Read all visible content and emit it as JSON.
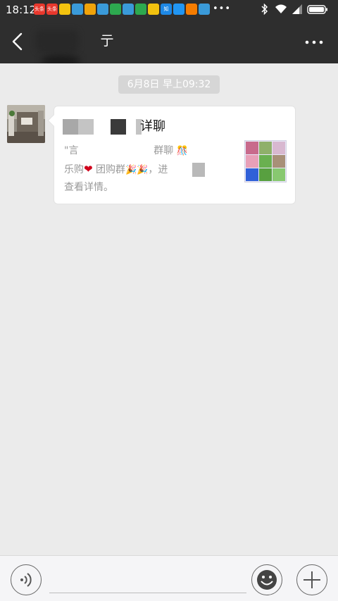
{
  "status_bar": {
    "time": "18:12",
    "notification_icons": [
      {
        "name": "toutiao-icon",
        "label": "头条",
        "color": "#e8382d"
      },
      {
        "name": "toutiao-icon",
        "label": "头条",
        "color": "#e8382d"
      },
      {
        "name": "app-yellow-icon",
        "label": "",
        "color": "#f2c20f"
      },
      {
        "name": "video-play-icon",
        "label": "",
        "color": "#3a9ad9"
      },
      {
        "name": "app-news-icon",
        "label": "",
        "color": "#f0a30a"
      },
      {
        "name": "video-play-icon",
        "label": "",
        "color": "#3a9ad9"
      },
      {
        "name": "app-green-icon",
        "label": "",
        "color": "#2da94f"
      },
      {
        "name": "video-play-icon",
        "label": "",
        "color": "#3a9ad9"
      },
      {
        "name": "app-green-icon",
        "label": "",
        "color": "#2da94f"
      },
      {
        "name": "app-yellow-icon",
        "label": "",
        "color": "#f2c20f"
      },
      {
        "name": "zhihu-icon",
        "label": "知",
        "color": "#1e88e5"
      },
      {
        "name": "app-blue-icon",
        "label": "",
        "color": "#2196f3"
      },
      {
        "name": "uc-icon",
        "label": "",
        "color": "#f57c00"
      },
      {
        "name": "video-play-icon",
        "label": "",
        "color": "#3a9ad9"
      }
    ],
    "more": "•••",
    "system_icons": [
      "bluetooth-icon",
      "wifi-icon",
      "signal-icon",
      "battery-icon"
    ]
  },
  "header": {
    "title": "              亍",
    "back_icon": "chevron-left-icon",
    "more_icon": "more-dots-icon"
  },
  "chat": {
    "timestamp": "6月8日 早上09:32",
    "card": {
      "title": "详聊",
      "desc_line1": "\"言                        群聊",
      "desc_line2_a": "乐购",
      "desc_line2_b": " 团购群",
      "desc_line2_c": "，进",
      "desc_line3": "查看详情。"
    }
  },
  "input_bar": {
    "voice_icon": "voice-icon",
    "emoji_icon": "emoji-icon",
    "plus_icon": "plus-icon"
  },
  "colors": {
    "header_bg": "#2e2e2e",
    "chat_bg": "#ebebeb",
    "timestamp_bg": "#d6d6d6",
    "heart": "#d0021b"
  }
}
